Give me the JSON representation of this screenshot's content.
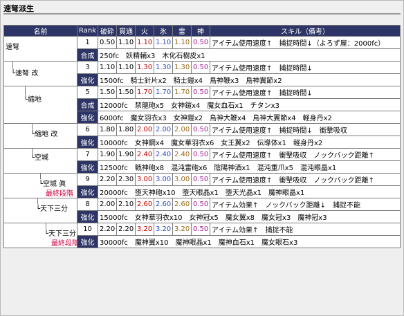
{
  "page_title": "速弩派生",
  "headers": {
    "name": "名前",
    "rank": "Rank",
    "ha": "破砕",
    "kan": "貫通",
    "hi": "火",
    "kori": "氷",
    "rai": "雷",
    "kami": "神",
    "skill": "スキル（備考）"
  },
  "rows": [
    {
      "name": "速弩",
      "final": "",
      "indent": "",
      "row1": {
        "tag": "1",
        "ha": "0.50",
        "kan": "1.10",
        "hi": "1.10",
        "kori": "1.10",
        "rai": "1.10",
        "kami": "0.50",
        "skill": "アイテム使用速度↑　捕捉時間↓（よろず屋：2000fc）"
      },
      "row2": {
        "tag": "合成",
        "text": "250fc　妖精輔x3　木化石樹皮x1"
      }
    },
    {
      "name": "└速弩 改",
      "final": "",
      "indent": "",
      "row1": {
        "tag": "3",
        "ha": "1.10",
        "kan": "1.10",
        "hi": "1.30",
        "kori": "1.30",
        "rai": "1.30",
        "kami": "0.50",
        "skill": "アイテム使用速度↑　捕捉時間↓"
      },
      "row2": {
        "tag": "強化",
        "text": "1500fc　騎士針片x2　騎士鎧x4　鳥神鞭x3　鳥神翼節x2"
      }
    },
    {
      "name": "└縮地",
      "final": "",
      "indent": "",
      "row1": {
        "tag": "5",
        "ha": "1.50",
        "kan": "1.50",
        "hi": "1.70",
        "kori": "1.70",
        "rai": "1.70",
        "kami": "0.50",
        "skill": "アイテム使用速度↑　捕捉時間↓"
      },
      "row2a": {
        "tag": "合成",
        "text": "12000fc　禁龍砲x5　女神鎧x4　魔女血石x1　チタンx3"
      },
      "row2": {
        "tag": "強化",
        "text": "6000fc　魔女羽衣x3　女神鎧x2　鳥神大鞭x4　鳥神大翼節x4　軽身丹x2"
      }
    },
    {
      "name": "└縮地 改",
      "final": "",
      "indent": "",
      "row1": {
        "tag": "6",
        "ha": "1.80",
        "kan": "1.80",
        "hi": "2.00",
        "kori": "2.00",
        "rai": "2.00",
        "kami": "0.50",
        "skill": "アイテム使用速度↑　捕捉時間↓　衝撃吸収"
      },
      "row2": {
        "tag": "強化",
        "text": "10000fc　女神鋼x4　魔女華羽衣x6　女王翼x2　伝導体x1　軽身丹x2"
      }
    },
    {
      "name": "└空城",
      "final": "",
      "indent": "",
      "row1": {
        "tag": "7",
        "ha": "1.90",
        "kan": "1.90",
        "hi": "2.40",
        "kori": "2.40",
        "rai": "2.40",
        "kami": "0.50",
        "skill": "アイテム使用速度↑　衝撃吸収　ノックバック距離↑"
      },
      "row2": {
        "tag": "強化",
        "text": "12500fc　戦神砲x8　混沌雷砲x6　陰陽神酒x1　混沌重爪x5　混沌眼晶x1"
      }
    },
    {
      "name": "└空城 眞",
      "final": "最終段階",
      "indent": "",
      "row1": {
        "tag": "9",
        "ha": "2.20",
        "kan": "2.30",
        "hi": "3.00",
        "kori": "3.00",
        "rai": "3.00",
        "kami": "0.50",
        "skill": "アイテム使用速度↑　衝撃吸収　ノックバック距離↑"
      },
      "row2": {
        "tag": "強化",
        "text": "20000fc　堕天神砲x10　堕天眼晶x1　堕天光晶x1　魔神眼晶x1"
      }
    },
    {
      "name": "└天下三分",
      "final": "",
      "indent": "",
      "row1": {
        "tag": "8",
        "ha": "2.00",
        "kan": "2.10",
        "hi": "2.60",
        "kori": "2.60",
        "rai": "2.60",
        "kami": "0.50",
        "skill": "アイテム効果↑　ノックバック距離↓　捕捉不能"
      },
      "row2": {
        "tag": "強化",
        "text": "15000fc　女神華羽衣x10　女神冠x5　魔女翼x8　魔女冠x3　魔神冠x3"
      }
    },
    {
      "name": "└天下三分 眞",
      "final": "最終段階",
      "indent": "",
      "row1": {
        "tag": "10",
        "ha": "2.20",
        "kan": "2.20",
        "hi": "3.20",
        "kori": "3.20",
        "rai": "3.20",
        "kami": "0.50",
        "skill": "アイテム効果↑　捕捉不能"
      },
      "row2": {
        "tag": "強化",
        "text": "30000fc　魔神翼x10　魔神眼晶x1　魔神血石x1　魔女眼石x3"
      }
    }
  ]
}
